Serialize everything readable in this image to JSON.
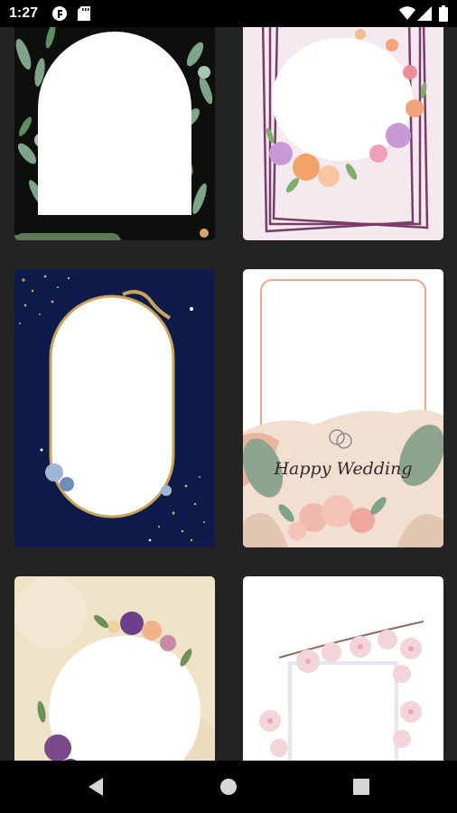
{
  "status_bar": {
    "time": "1:27",
    "icons": [
      "notification-app-icon",
      "sd-card-icon",
      "wifi-icon",
      "signal-icon",
      "battery-icon"
    ]
  },
  "templates": [
    {
      "name": "green-leaves-arch-frame"
    },
    {
      "name": "purple-floral-lines-frame"
    },
    {
      "name": "navy-gold-oval-frame"
    },
    {
      "name": "peach-tropical-wedding-frame",
      "caption": "Happy Wedding"
    },
    {
      "name": "vintage-purple-floral-circle-frame"
    },
    {
      "name": "cherry-blossom-square-frame"
    }
  ],
  "nav_bar": {
    "buttons": [
      "back",
      "home",
      "recents"
    ]
  },
  "colors": {
    "background": "#232323",
    "status_bar": "#000000",
    "nav_bar": "#000000",
    "navy": "#0d1a4a",
    "gold": "#c9a35a",
    "purple_line": "#7a3c68",
    "sage": "#8fa48f",
    "blush": "#f0b9b0"
  }
}
